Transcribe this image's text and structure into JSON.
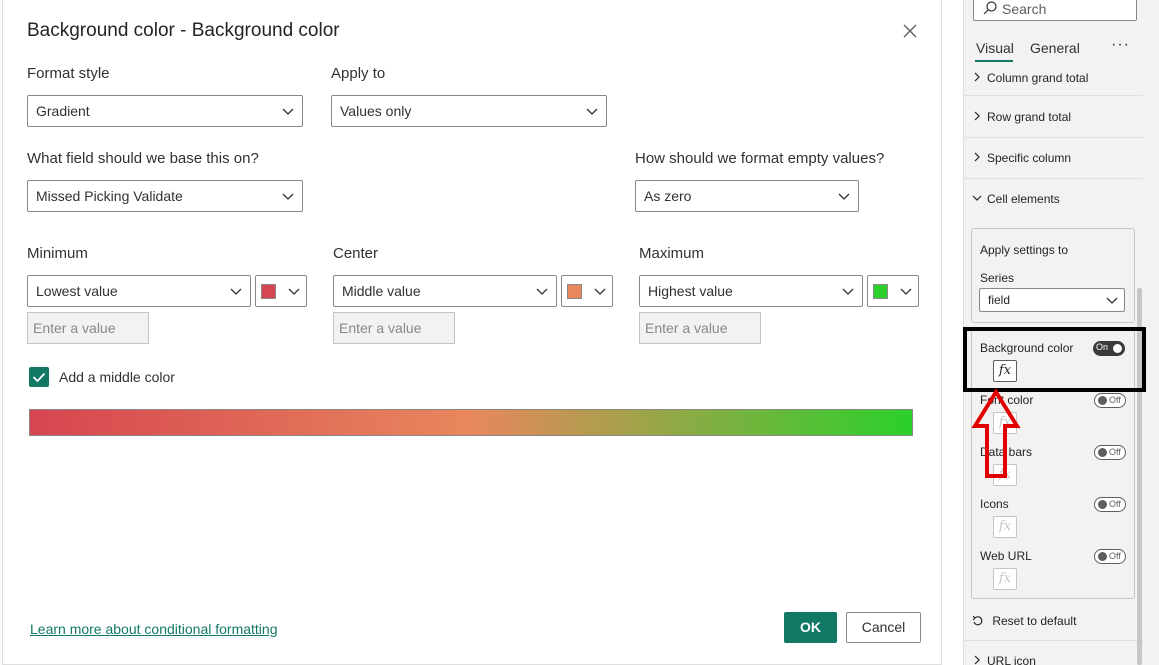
{
  "dialog": {
    "title": "Background color - Background color",
    "format_style_label": "Format style",
    "format_style_value": "Gradient",
    "apply_to_label": "Apply to",
    "apply_to_value": "Values only",
    "field_label": "What field should we base this on?",
    "field_value": "Missed Picking Validate",
    "empty_label": "How should we format empty values?",
    "empty_value": "As zero",
    "minimum": {
      "label": "Minimum",
      "value": "Lowest value",
      "color": "#d64550",
      "placeholder": "Enter a value"
    },
    "center": {
      "label": "Center",
      "value": "Middle value",
      "color": "#e8875d",
      "placeholder": "Enter a value"
    },
    "maximum": {
      "label": "Maximum",
      "value": "Highest value",
      "color": "#2bd02b",
      "placeholder": "Enter a value"
    },
    "middle_color_label": "Add a middle color",
    "middle_color_checked": true,
    "learn_more": "Learn more about conditional formatting",
    "ok_label": "OK",
    "cancel_label": "Cancel"
  },
  "pane": {
    "search_placeholder": "Search",
    "tabs": [
      {
        "label": "Visual",
        "active": true
      },
      {
        "label": "General",
        "active": false
      }
    ],
    "more": "···",
    "sections": [
      {
        "label": "Column grand total"
      },
      {
        "label": "Row grand total"
      },
      {
        "label": "Specific column"
      },
      {
        "label": "Cell elements"
      }
    ],
    "apply_settings": "Apply settings to",
    "series_label": "Series",
    "series_value": "field",
    "settings": [
      {
        "label": "Background color",
        "toggle": "On"
      },
      {
        "label": "Font color",
        "toggle": "Off"
      },
      {
        "label": "Data bars",
        "toggle": "Off"
      },
      {
        "label": "Icons",
        "toggle": "Off"
      },
      {
        "label": "Web URL",
        "toggle": "Off"
      }
    ],
    "fx_label": "fx",
    "reset": "Reset to default",
    "url_icon": "URL icon"
  },
  "colors": {
    "accent": "#117865",
    "arrow": "#e00000"
  }
}
